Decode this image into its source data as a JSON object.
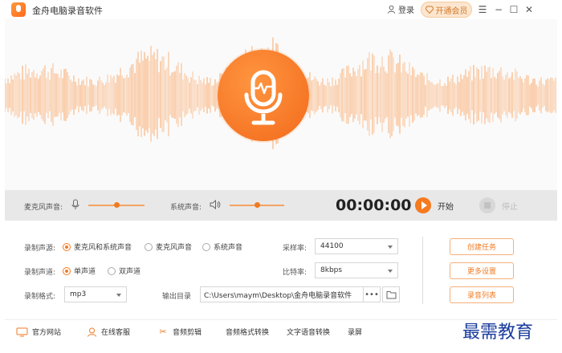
{
  "window": {
    "title": "金舟电脑录音软件",
    "login_label": "登录",
    "vip_label": "开通会员",
    "controls": [
      "menu",
      "minimize",
      "maximize",
      "close"
    ]
  },
  "record": {
    "mic_volume_label": "麦克风声音:",
    "mic_volume_level": 0.5,
    "system_volume_label": "系统声音:",
    "system_volume_level": 0.5,
    "timer": "00:00:00",
    "start_label": "开始",
    "stop_label": "停止"
  },
  "settings": {
    "source_label": "录制声源:",
    "source_options": [
      {
        "label": "麦克风和系统声音",
        "selected": true
      },
      {
        "label": "麦克风声音",
        "selected": false
      },
      {
        "label": "系统声音",
        "selected": false
      }
    ],
    "channel_label": "录制声道:",
    "channel_options": [
      {
        "label": "单声道",
        "selected": true
      },
      {
        "label": "双声道",
        "selected": false
      }
    ],
    "format_label": "录制格式:",
    "format_value": "mp3",
    "sample_rate_label": "采样率:",
    "sample_rate_value": "44100",
    "bitrate_label": "比特率:",
    "bitrate_value": "8kbps",
    "output_label": "输出目录",
    "output_path": "C:\\Users\\maym\\Desktop\\金舟电脑录音软件",
    "more_label": "•••"
  },
  "actions": {
    "create_task": "创建任务",
    "more_settings": "更多设置",
    "recording_list": "录音列表"
  },
  "footer": {
    "items": [
      "官方网站",
      "在线客服",
      "音频剪辑",
      "音频格式转换",
      "文字语音转换",
      "录屏"
    ]
  },
  "watermark": "最需教育",
  "colors": {
    "accent": "#f57a20",
    "wave": "#f9b27a",
    "control_bar": "#e8e8e8"
  }
}
